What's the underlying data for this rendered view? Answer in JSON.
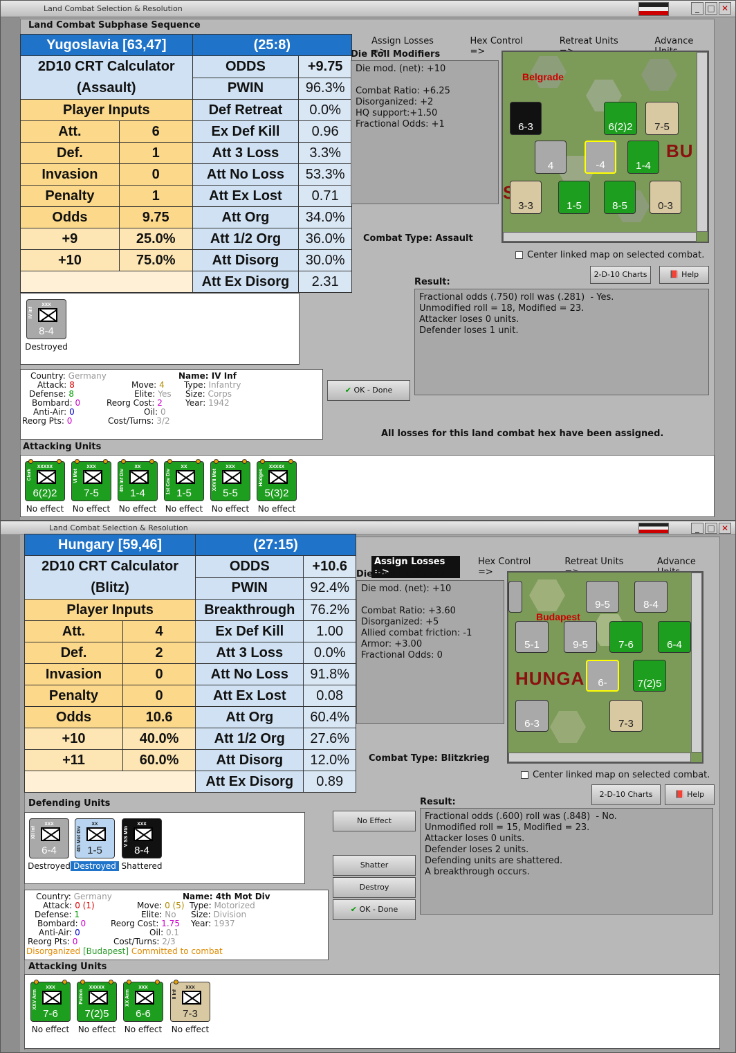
{
  "w1": {
    "title": "Land Combat Selection & Resolution",
    "subtitle": "Land Combat Subphase Sequence",
    "phases": [
      "Assign Losses =>",
      "Hex Control =>",
      "Retreat Units =>",
      "Advance Units"
    ],
    "crt": {
      "hex": "Yugoslavia [63,47]",
      "turn": "(25:8)",
      "calc1": "2D10 CRT Calculator",
      "calc2": "(Assault)",
      "player_inputs": "Player Inputs",
      "inputs": [
        [
          "Att.",
          "6"
        ],
        [
          "Def.",
          "1"
        ],
        [
          "Invasion",
          "0"
        ],
        [
          "Penalty",
          "1"
        ],
        [
          "Odds",
          "9.75"
        ],
        [
          "+9",
          "25.0%"
        ],
        [
          "+10",
          "75.0%"
        ]
      ],
      "results": [
        [
          "ODDS",
          "+9.75"
        ],
        [
          "PWIN",
          "96.3%"
        ],
        [
          "Def Retreat",
          "0.0%"
        ],
        [
          "Ex Def Kill",
          "0.96"
        ],
        [
          "Att 3 Loss",
          "3.3%"
        ],
        [
          "Att No Loss",
          "53.3%"
        ],
        [
          "Att Ex Lost",
          "0.71"
        ],
        [
          "Att Org",
          "34.0%"
        ],
        [
          "Att 1/2 Org",
          "36.0%"
        ],
        [
          "Att Disorg",
          "30.0%"
        ],
        [
          "Att Ex Disorg",
          "2.31"
        ]
      ]
    },
    "drm_title": "Die Roll Modifiers",
    "drm_text": "Die mod. (net): +10\n\nCombat Ratio: +6.25\nDisorganized: +2\nHQ support:+1.50\nFractional Odds: +1",
    "combat_type": "Combat Type:  Assault",
    "map": {
      "town": "Belgrade",
      "region": "BU",
      "region2": "S"
    },
    "center_map": "Center linked map on selected combat.",
    "charts_btn": "2-D-10 Charts",
    "help_btn": "Help",
    "result_label": "Result:",
    "result_text": "Fractional odds (.750) roll was (.281)  - Yes.\nUnmodified roll = 18, Modified = 23.\nAttacker loses 0 units.\nDefender loses 1 unit.",
    "ok_btn": "OK - Done",
    "all_losses": "All losses for this land combat hex have been assigned.",
    "defender": {
      "size": "xxx",
      "name": "IV Inf",
      "str": "8-4",
      "status": "Destroyed"
    },
    "info": {
      "country_l": "Country:",
      "country": "Germany",
      "attack_l": "Attack:",
      "attack": "8",
      "defense_l": "Defense:",
      "defense": "8",
      "bombard_l": "Bombard:",
      "bombard": "0",
      "antiair_l": "Anti-Air:",
      "antiair": "0",
      "reorg_l": "Reorg Pts:",
      "reorg": "0",
      "move_l": "Move:",
      "move": "4",
      "elite_l": "Elite:",
      "elite": "Yes",
      "rcost_l": "Reorg Cost:",
      "rcost": "2",
      "oil_l": "Oil:",
      "oil": "0",
      "cost_l": "Cost/Turns:",
      "cost": "3/2",
      "name_l": "Name:",
      "name": "IV Inf",
      "type_l": "Type:",
      "type": "Infantry",
      "size_l": "Size:",
      "size": "Corps",
      "year_l": "Year:",
      "year": "1942"
    },
    "attacking_label": "Attacking Units",
    "attackers": [
      {
        "size": "xxxxx",
        "name": "Clark",
        "str": "6(2)2",
        "status": "No effect"
      },
      {
        "size": "xxx",
        "name": "VI Mot",
        "str": "7-5",
        "status": "No effect"
      },
      {
        "size": "xx",
        "name": "4th Inf Div",
        "str": "1-4",
        "status": "No effect"
      },
      {
        "size": "xx",
        "name": "1st Cav Div",
        "str": "1-5",
        "status": "No effect"
      },
      {
        "size": "xxx",
        "name": "XXVII Mot",
        "str": "5-5",
        "status": "No effect"
      },
      {
        "size": "xxxxx",
        "name": "Hodges",
        "str": "5(3)2",
        "status": "No effect"
      }
    ]
  },
  "w2": {
    "title": "Land Combat Selection & Resolution",
    "phases": [
      "Assign Losses =>",
      "Hex Control =>",
      "Retreat Units =>",
      "Advance Units"
    ],
    "crt": {
      "hex": "Hungary [59,46]",
      "turn": "(27:15)",
      "calc1": "2D10 CRT Calculator",
      "calc2": "(Blitz)",
      "player_inputs": "Player Inputs",
      "inputs": [
        [
          "Att.",
          "4"
        ],
        [
          "Def.",
          "2"
        ],
        [
          "Invasion",
          "0"
        ],
        [
          "Penalty",
          "0"
        ],
        [
          "Odds",
          "10.6"
        ],
        [
          "+10",
          "40.0%"
        ],
        [
          "+11",
          "60.0%"
        ]
      ],
      "results": [
        [
          "ODDS",
          "+10.6"
        ],
        [
          "PWIN",
          "92.4%"
        ],
        [
          "Breakthrough",
          "76.2%"
        ],
        [
          "Ex Def Kill",
          "1.00"
        ],
        [
          "Att 3 Loss",
          "0.0%"
        ],
        [
          "Att No Loss",
          "91.8%"
        ],
        [
          "Att Ex Lost",
          "0.08"
        ],
        [
          "Att Org",
          "60.4%"
        ],
        [
          "Att 1/2 Org",
          "27.6%"
        ],
        [
          "Att Disorg",
          "12.0%"
        ],
        [
          "Att Ex Disorg",
          "0.89"
        ]
      ]
    },
    "drm_title": "Die Roll Modifiers",
    "drm_text": "Die mod. (net): +10\n\nCombat Ratio: +3.60\nDisorganized: +5\nAllied combat friction: -1\nArmor: +3.00\nFractional Odds: 0",
    "combat_type": "Combat Type:  Blitzkrieg",
    "map": {
      "town": "Budapest",
      "region": "HUNGA"
    },
    "center_map": "Center linked map on selected combat.",
    "charts_btn": "2-D-10 Charts",
    "help_btn": "Help",
    "result_label": "Result:",
    "result_text": "Fractional odds (.600) roll was (.848)  - No.\nUnmodified roll = 15, Modified = 23.\nAttacker loses 0 units.\nDefender loses 2 units.\nDefending units are shattered.\nA breakthrough occurs.",
    "no_effect_btn": "No Effect",
    "shatter_btn": "Shatter",
    "destroy_btn": "Destroy",
    "ok_btn": "OK - Done",
    "defending_label": "Defending Units",
    "defenders": [
      {
        "size": "xxx",
        "name": "XII Inf",
        "str": "6-4",
        "status": "Destroyed"
      },
      {
        "size": "xx",
        "name": "4th Mot Div",
        "str": "1-5",
        "status": "Destroyed"
      },
      {
        "size": "xxx",
        "name": "V SS Mtn",
        "str": "8-4",
        "status": "Shattered"
      }
    ],
    "info": {
      "country_l": "Country:",
      "country": "Germany",
      "attack_l": "Attack:",
      "attack": "0 (1)",
      "defense_l": "Defense:",
      "defense": "1",
      "bombard_l": "Bombard:",
      "bombard": "0",
      "antiair_l": "Anti-Air:",
      "antiair": "0",
      "reorg_l": "Reorg Pts:",
      "reorg": "0",
      "move_l": "Move:",
      "move": "0 (5)",
      "elite_l": "Elite:",
      "elite": "No",
      "rcost_l": "Reorg Cost:",
      "rcost": "1.75",
      "oil_l": "Oil:",
      "oil": "0.1",
      "cost_l": "Cost/Turns:",
      "cost": "2/3",
      "name_l": "Name:",
      "name": "4th Mot Div",
      "type_l": "Type:",
      "type": "Motorized",
      "size_l": "Size:",
      "size": "Division",
      "year_l": "Year:",
      "year": "1937",
      "status1": "Disorganized",
      "status2": "[Budapest]",
      "status3": "Committed to combat"
    },
    "attacking_label": "Attacking Units",
    "attackers": [
      {
        "size": "xxx",
        "name": "XXV Arm",
        "str": "7-6",
        "status": "No effect"
      },
      {
        "size": "xxxxx",
        "name": "Patton",
        "str": "7(2)5",
        "status": "No effect"
      },
      {
        "size": "xxx",
        "name": "XX Arm",
        "str": "6-6",
        "status": "No effect"
      },
      {
        "size": "xxx",
        "name": "II Inf",
        "str": "7-3",
        "status": "No effect"
      }
    ]
  }
}
